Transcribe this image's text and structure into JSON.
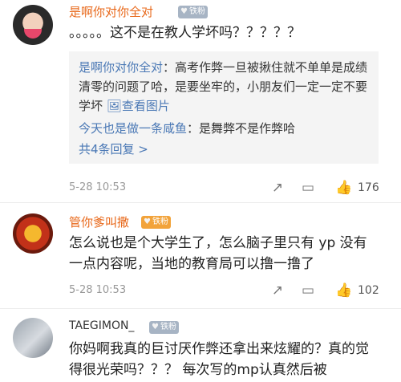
{
  "comments": [
    {
      "user": "是啊你对你全对",
      "badge": "铁粉",
      "text": "。。。。。这不是在教人学坏吗？？？？？",
      "replies": [
        {
          "user": "是啊你对你全对",
          "text": "高考作弊一旦被揪住就不单单是成绩清零的问题了哈，是要坐牢的，小朋友们一定一定不要学坏",
          "link": "查看图片"
        },
        {
          "user": "今天也是做一条咸鱼",
          "text": "是舞弊不是作弊哈"
        }
      ],
      "more_replies": "共4条回复 >",
      "time": "5-28 10:53",
      "likes": "176",
      "icons": [
        "share-icon",
        "comment-icon",
        "like-icon"
      ]
    },
    {
      "user": "管你爹叫撒",
      "badge": "铁粉",
      "text": "怎么说也是个大学生了，怎么脑子里只有 yp 没有一点内容呢，当地的教育局可以撸一撸了",
      "time": "5-28 10:53",
      "likes": "102",
      "icons": [
        "share-icon",
        "comment-icon",
        "like-icon"
      ]
    },
    {
      "user": "TAEGIMON_",
      "badge": "铁粉",
      "text": "你妈啊我真的巨讨厌作弊还拿出来炫耀的？真的觉得很光荣吗？？？ 每次写的mp认真然后被"
    }
  ]
}
